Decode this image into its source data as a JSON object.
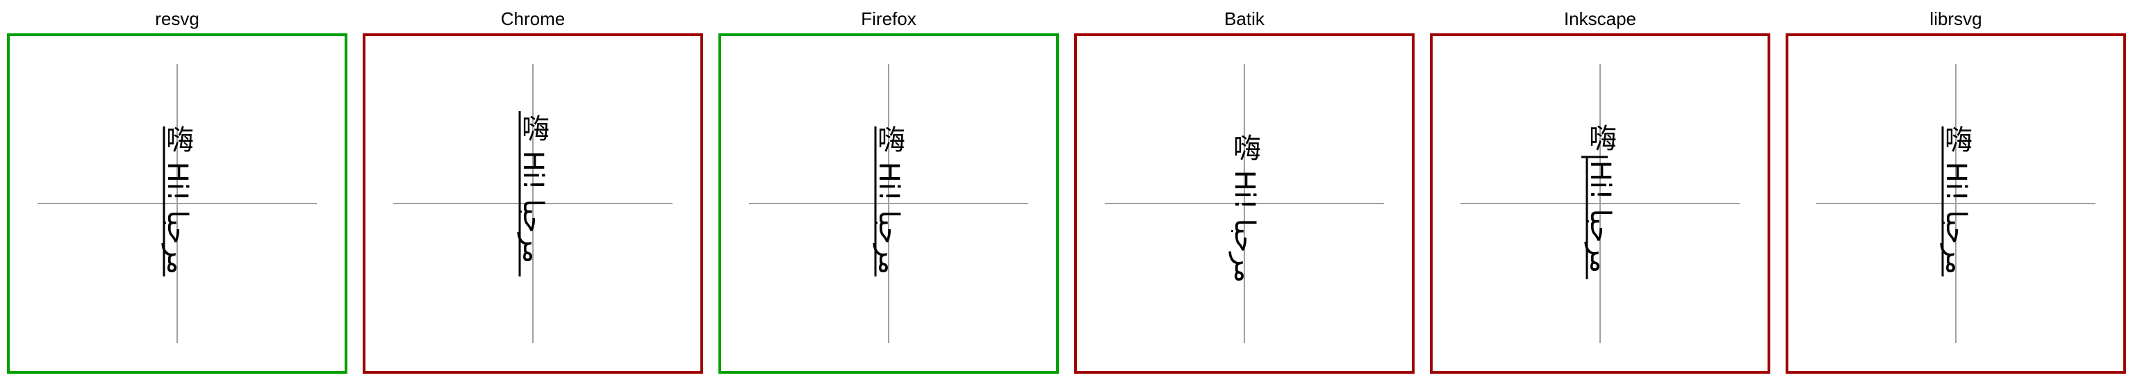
{
  "cells": [
    {
      "title": "resvg",
      "status": "pass",
      "sample_text": "嗨 Hi! مرحبا"
    },
    {
      "title": "Chrome",
      "status": "fail",
      "sample_text": "嗨 Hi! مرحبا"
    },
    {
      "title": "Firefox",
      "status": "pass",
      "sample_text": "嗨 Hi! مرحبا"
    },
    {
      "title": "Batik",
      "status": "fail",
      "sample_text": "嗨 Hi! مرحبا"
    },
    {
      "title": "Inkscape",
      "status": "fail",
      "sample_text": "嗨 Hi! مرحبا"
    },
    {
      "title": "librsvg",
      "status": "fail",
      "sample_text": "嗨 Hi! مرحبا"
    }
  ],
  "colors": {
    "pass_border": "#00a000",
    "fail_border": "#a00000",
    "crosshair": "#a0a0a0",
    "text": "#000000"
  }
}
